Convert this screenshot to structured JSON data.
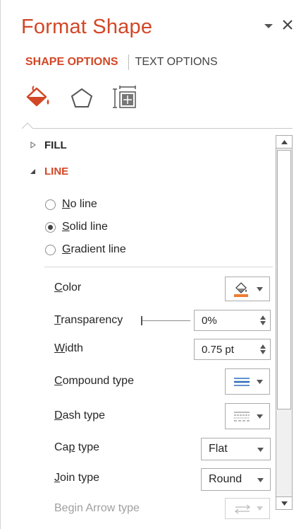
{
  "pane": {
    "title": "Format Shape",
    "tabs": [
      {
        "label": "SHAPE OPTIONS",
        "active": true
      },
      {
        "label": "TEXT OPTIONS",
        "active": false
      }
    ],
    "category_icons": [
      "fill-line-icon",
      "effects-icon",
      "size-properties-icon"
    ],
    "accent_color": "#d24726"
  },
  "sections": {
    "fill": {
      "label": "FILL",
      "expanded": false
    },
    "line": {
      "label": "LINE",
      "expanded": true
    }
  },
  "line_options": [
    {
      "mnemonic": "N",
      "rest": "o line",
      "selected": false
    },
    {
      "mnemonic": "S",
      "rest": "olid line",
      "selected": true
    },
    {
      "mnemonic": "G",
      "rest": "radient line",
      "selected": false
    }
  ],
  "properties": {
    "color": {
      "mnemonic": "C",
      "rest": "olor",
      "swatch": "#ed7d31"
    },
    "transparency": {
      "mnemonic": "T",
      "rest": "ransparency",
      "value": "0%",
      "level": 0
    },
    "width": {
      "mnemonic": "W",
      "rest": "idth",
      "value": "0.75 pt"
    },
    "compound": {
      "mnemonic": "C",
      "rest": "ompound type"
    },
    "dash": {
      "mnemonic": "D",
      "rest": "ash type"
    },
    "cap": {
      "pre": "Ca",
      "mnemonic": "p",
      "rest": " type",
      "value": "Flat"
    },
    "join": {
      "mnemonic": "J",
      "rest": "oin type",
      "value": "Round"
    },
    "begin_arrow": {
      "label": "Begin Arrow type"
    }
  }
}
